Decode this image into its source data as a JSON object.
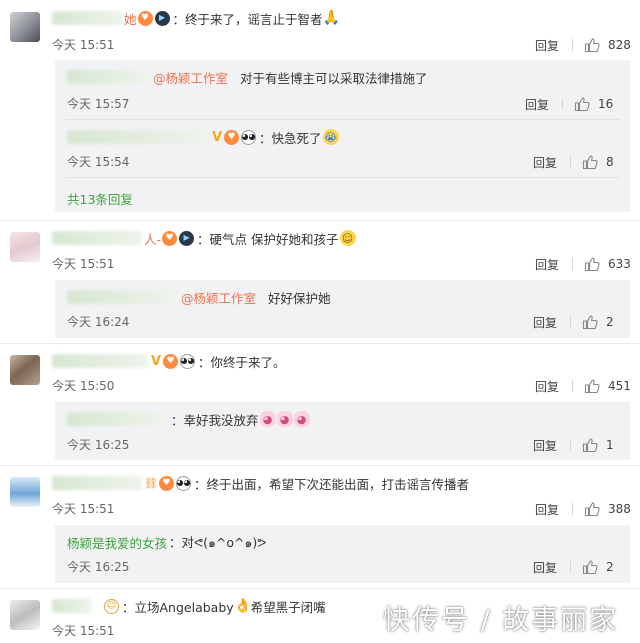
{
  "labels": {
    "reply": "回复"
  },
  "comments": [
    {
      "name_tail": "她",
      "text": "：终于来了，谣言止于智者",
      "time": "今天 15:51",
      "likes": "828",
      "replies": [
        {
          "mention": "@杨颖工作室",
          "text": "对于有些博主可以采取法律措施了",
          "time": "今天 15:57",
          "likes": "16"
        },
        {
          "text": "：快急死了",
          "time": "今天 15:54",
          "likes": "8"
        }
      ],
      "more_replies": "共13条回复"
    },
    {
      "name_tail": "人-",
      "text": "：硬气点 保护好她和孩子",
      "time": "今天 15:51",
      "likes": "633",
      "replies": [
        {
          "mention": "@杨颖工作室",
          "text": "好好保护她",
          "time": "今天 16:24",
          "likes": "2"
        }
      ]
    },
    {
      "text": "：你终于来了。",
      "time": "今天 15:50",
      "likes": "451",
      "replies": [
        {
          "text": "：幸好我没放弃",
          "time": "今天 16:25",
          "likes": "1"
        }
      ]
    },
    {
      "text": "：终于出面，希望下次还能出面，打击谣言传播者",
      "time": "今天 15:51",
      "likes": "388",
      "replies": [
        {
          "name": "杨颖是我爱的女孩",
          "text": "：对ᕙ(๑^o^๑)ᕗ",
          "time": "今天 16:25",
          "likes": "2"
        }
      ]
    },
    {
      "text": "：立场Angelababy",
      "text2": "希望黑子闭嘴",
      "time": "今天 15:51"
    }
  ],
  "watermark": "快传号 / 故事丽家",
  "colors": {
    "accent_orange": "#eb7350",
    "reply_green": "#3fa33f",
    "reply_bg": "#f2f2f5"
  }
}
